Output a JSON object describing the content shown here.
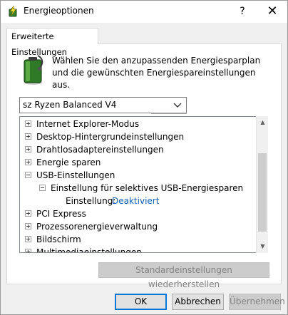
{
  "window": {
    "title": "Energieoptionen",
    "help_glyph": "?",
    "close_glyph": "✕"
  },
  "tabs": [
    {
      "label": "Erweiterte Einstellungen"
    }
  ],
  "description": "Wählen Sie den anzupassenden Energiesparplan und die gewünschten Energiespareinstellungen aus.",
  "plan_select": {
    "value": "sz Ryzen Balanced V4"
  },
  "tree": {
    "items": [
      {
        "label": "Internet Explorer-Modus",
        "expander": "plus",
        "level": 0
      },
      {
        "label": "Desktop-Hintergrundeinstellungen",
        "expander": "plus",
        "level": 0
      },
      {
        "label": "Drahtlosadaptereinstellungen",
        "expander": "plus",
        "level": 0
      },
      {
        "label": "Energie sparen",
        "expander": "plus",
        "level": 0
      },
      {
        "label": "USB-Einstellungen",
        "expander": "minus",
        "level": 0
      },
      {
        "label": "Einstellung für selektives USB-Energiesparen",
        "expander": "minus",
        "level": 1
      },
      {
        "label": "Einstellung:",
        "value": "Deaktiviert",
        "level": 2
      },
      {
        "label": "PCI Express",
        "expander": "plus",
        "level": 0
      },
      {
        "label": "Prozessorenergieverwaltung",
        "expander": "plus",
        "level": 0
      },
      {
        "label": "Bildschirm",
        "expander": "plus",
        "level": 0
      },
      {
        "label": "Multimediaeinstellungen",
        "expander": "plus",
        "level": 0
      }
    ]
  },
  "restore_button": {
    "label": "Standardeinstellungen wiederherstellen"
  },
  "buttons": {
    "ok": "OK",
    "cancel": "Abbrechen",
    "apply": "Übernehmen"
  },
  "colors": {
    "link": "#1160b5",
    "accent": "#0078d7"
  }
}
